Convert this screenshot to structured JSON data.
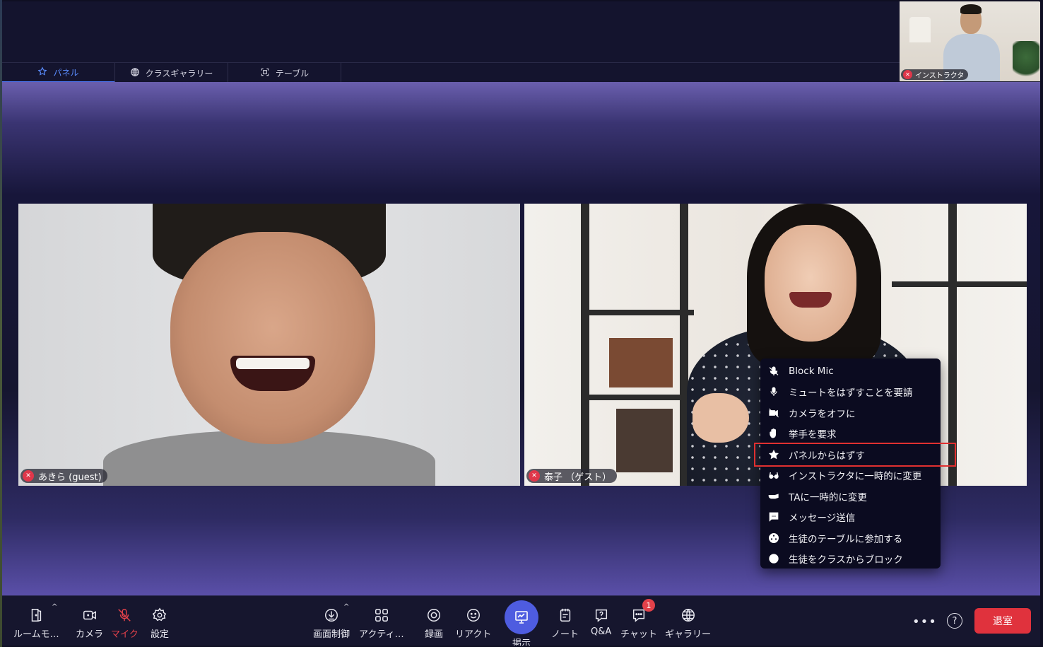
{
  "tabs": [
    {
      "label": "パネル",
      "icon": "star-icon",
      "active": true
    },
    {
      "label": "クラスギャラリー",
      "icon": "globe-icon",
      "active": false
    },
    {
      "label": "テーブル",
      "icon": "expand-icon",
      "active": false
    }
  ],
  "instructor": {
    "name": "インストラクタ",
    "mic": "muted"
  },
  "participants": [
    {
      "name": "あきら (guest)",
      "mic": "muted"
    },
    {
      "name": "泰子 （ゲスト）",
      "mic": "muted"
    }
  ],
  "context_menu": {
    "items": [
      {
        "label": "Block Mic",
        "icon": "block-mic-icon"
      },
      {
        "label": "ミュートをはずすことを要請",
        "icon": "mic-icon"
      },
      {
        "label": "カメラをオフに",
        "icon": "camera-off-icon"
      },
      {
        "label": "挙手を要求",
        "icon": "hand-icon"
      },
      {
        "label": "パネルからはずす",
        "icon": "star-icon",
        "highlighted": true
      },
      {
        "label": "インストラクタに一時的に変更",
        "icon": "glasses-icon"
      },
      {
        "label": "TAに一時的に変更",
        "icon": "whistle-icon"
      },
      {
        "label": "メッセージ送信",
        "icon": "message-icon"
      },
      {
        "label": "生徒のテーブルに参加する",
        "icon": "table-icon"
      },
      {
        "label": "生徒をクラスからブロック",
        "icon": "block-icon"
      }
    ]
  },
  "toolbar": {
    "room_mode": "ルームモ…",
    "camera": "カメラ",
    "mic": "マイク",
    "settings": "設定",
    "screen_control": "画面制御",
    "activities": "アクティ…",
    "record": "録画",
    "react": "リアクト",
    "present": "掲示",
    "notes": "ノート",
    "qa": "Q&A",
    "chat": "チャット",
    "chat_badge": "1",
    "gallery": "ギャラリー",
    "more": "•••",
    "help": "?",
    "leave": "退室"
  },
  "colors": {
    "accent": "#4f7cff",
    "leave": "#e0323d",
    "muted": "#e0374a",
    "present": "#4e5ce0"
  }
}
